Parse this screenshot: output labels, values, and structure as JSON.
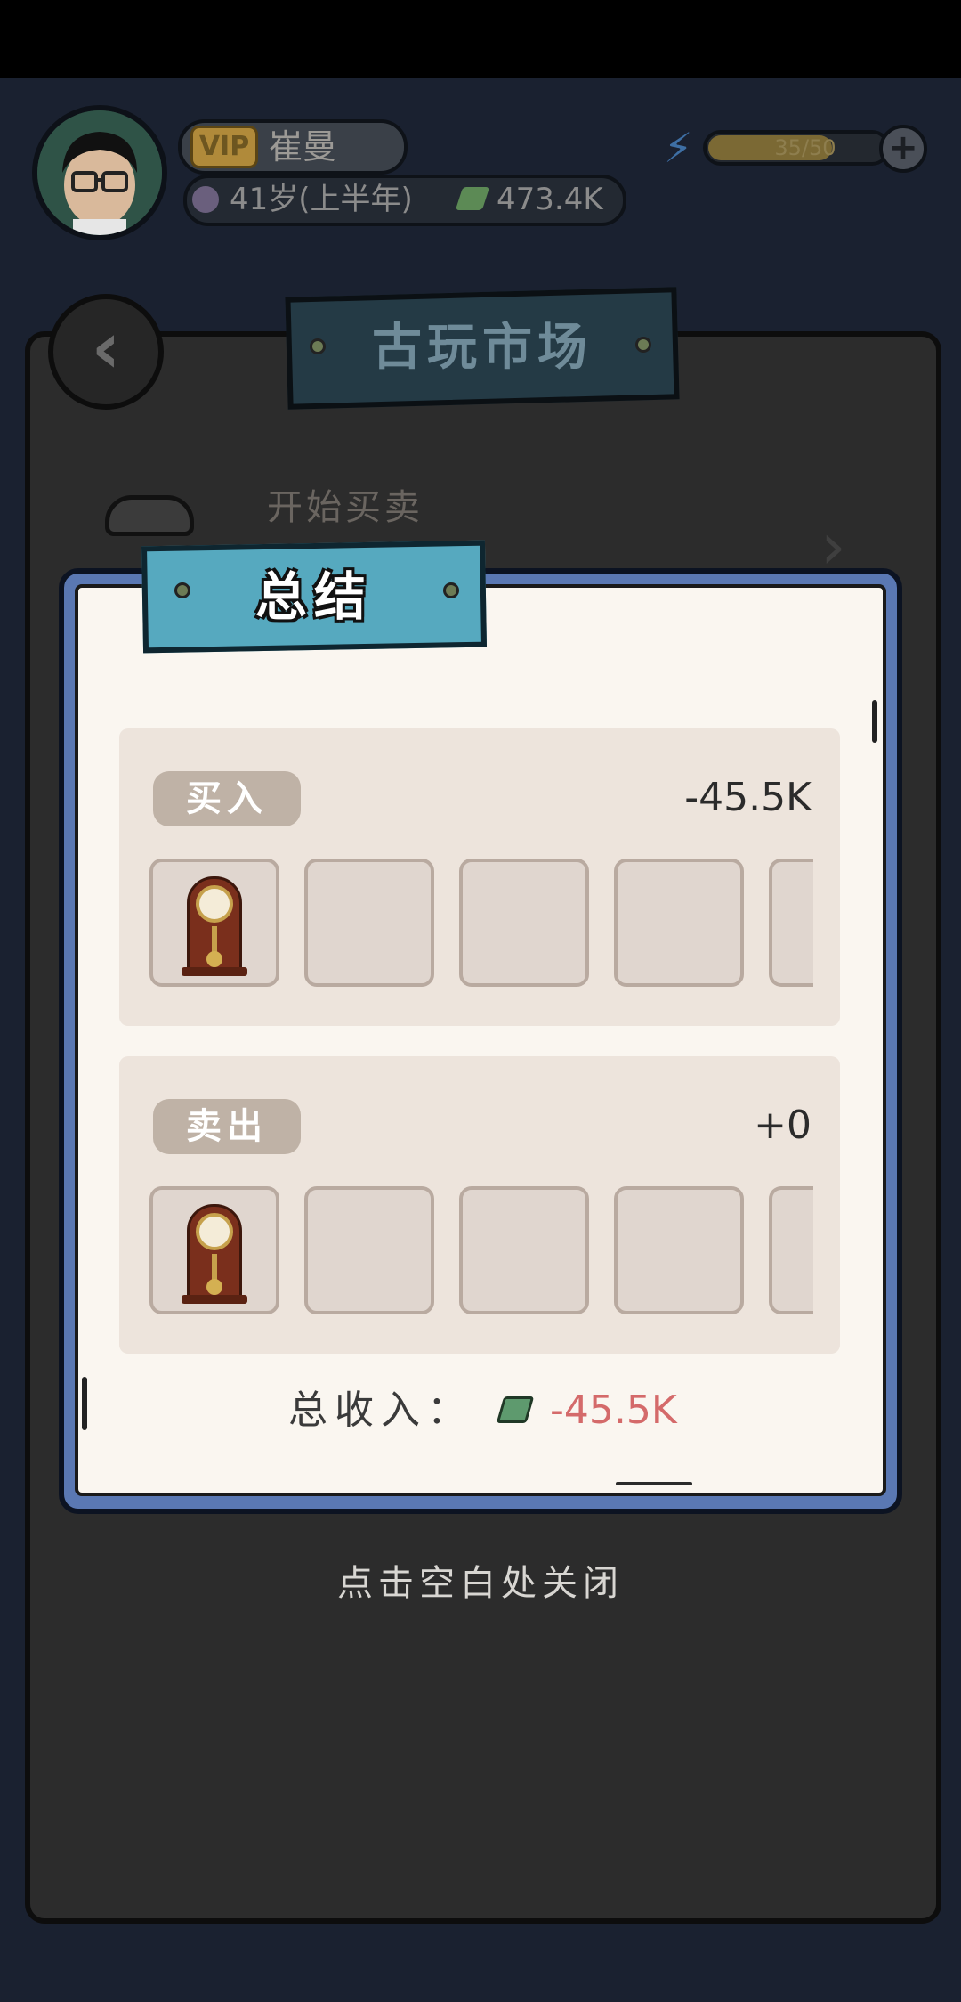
{
  "header": {
    "vip_label": "VIP",
    "player_name": "崔曼",
    "age": "41岁(上半年)",
    "money": "473.4K",
    "energy": "35/50",
    "energy_fraction": 0.7,
    "energy_plus": "+"
  },
  "screen": {
    "title": "古玩市场",
    "subtitle": "开始买卖",
    "back_glyph": "‹",
    "next_glyph": "›"
  },
  "summary": {
    "title": "总结",
    "buy": {
      "label": "买入",
      "amount": "-45.5K",
      "items": [
        "grandfather-clock"
      ]
    },
    "sell": {
      "label": "卖出",
      "amount": "+0",
      "items": [
        "grandfather-clock"
      ]
    },
    "total_label": "总收入：",
    "total_value": "-45.5K",
    "total_color": "#d46a6a"
  },
  "close_hint": "点击空白处关闭"
}
